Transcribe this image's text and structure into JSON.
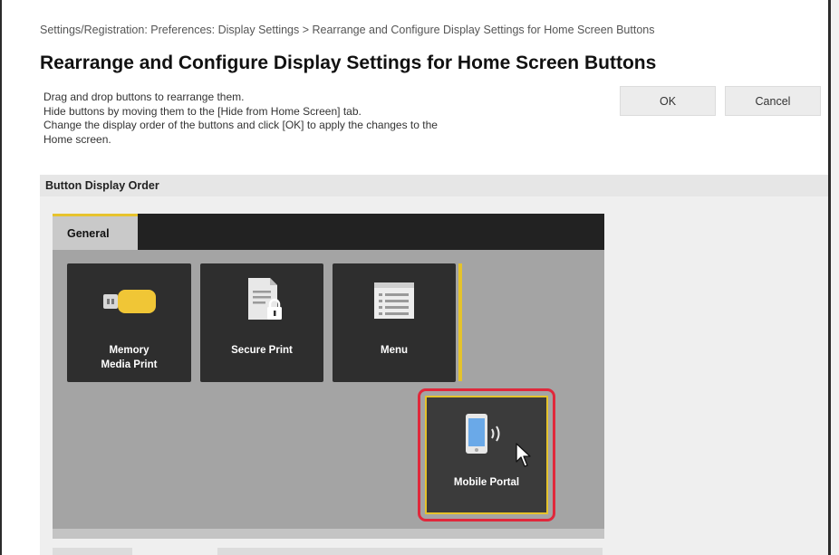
{
  "breadcrumb": "Settings/Registration: Preferences: Display Settings > Rearrange and Configure Display Settings for Home Screen Buttons",
  "page_title": "Rearrange and Configure Display Settings for Home Screen Buttons",
  "instructions": [
    "Drag and drop buttons to rearrange them.",
    "Hide buttons by moving them to the [Hide from Home Screen] tab.",
    "Change the display order of the buttons and click [OK] to apply the changes to the",
    "Home screen."
  ],
  "buttons": {
    "ok": "OK",
    "cancel": "Cancel"
  },
  "section": {
    "title": "Button Display Order"
  },
  "tabs": [
    {
      "label": "General",
      "active": true
    }
  ],
  "tiles": {
    "memory_media_print": {
      "label_line1": "Memory",
      "label_line2": "Media Print",
      "icon": "usb-drive-icon"
    },
    "secure_print": {
      "label": "Secure Print",
      "icon": "locked-document-icon"
    },
    "menu": {
      "label": "Menu",
      "icon": "menu-list-icon"
    },
    "mobile_portal": {
      "label": "Mobile Portal",
      "icon": "smartphone-wireless-icon",
      "state": "dragging"
    }
  },
  "colors": {
    "accent_yellow": "#e5c32b",
    "highlight_red": "#e0283b",
    "tile_dark": "#2e2e2e",
    "tab_bar": "#222222",
    "panel_grey": "#a4a4a4"
  }
}
